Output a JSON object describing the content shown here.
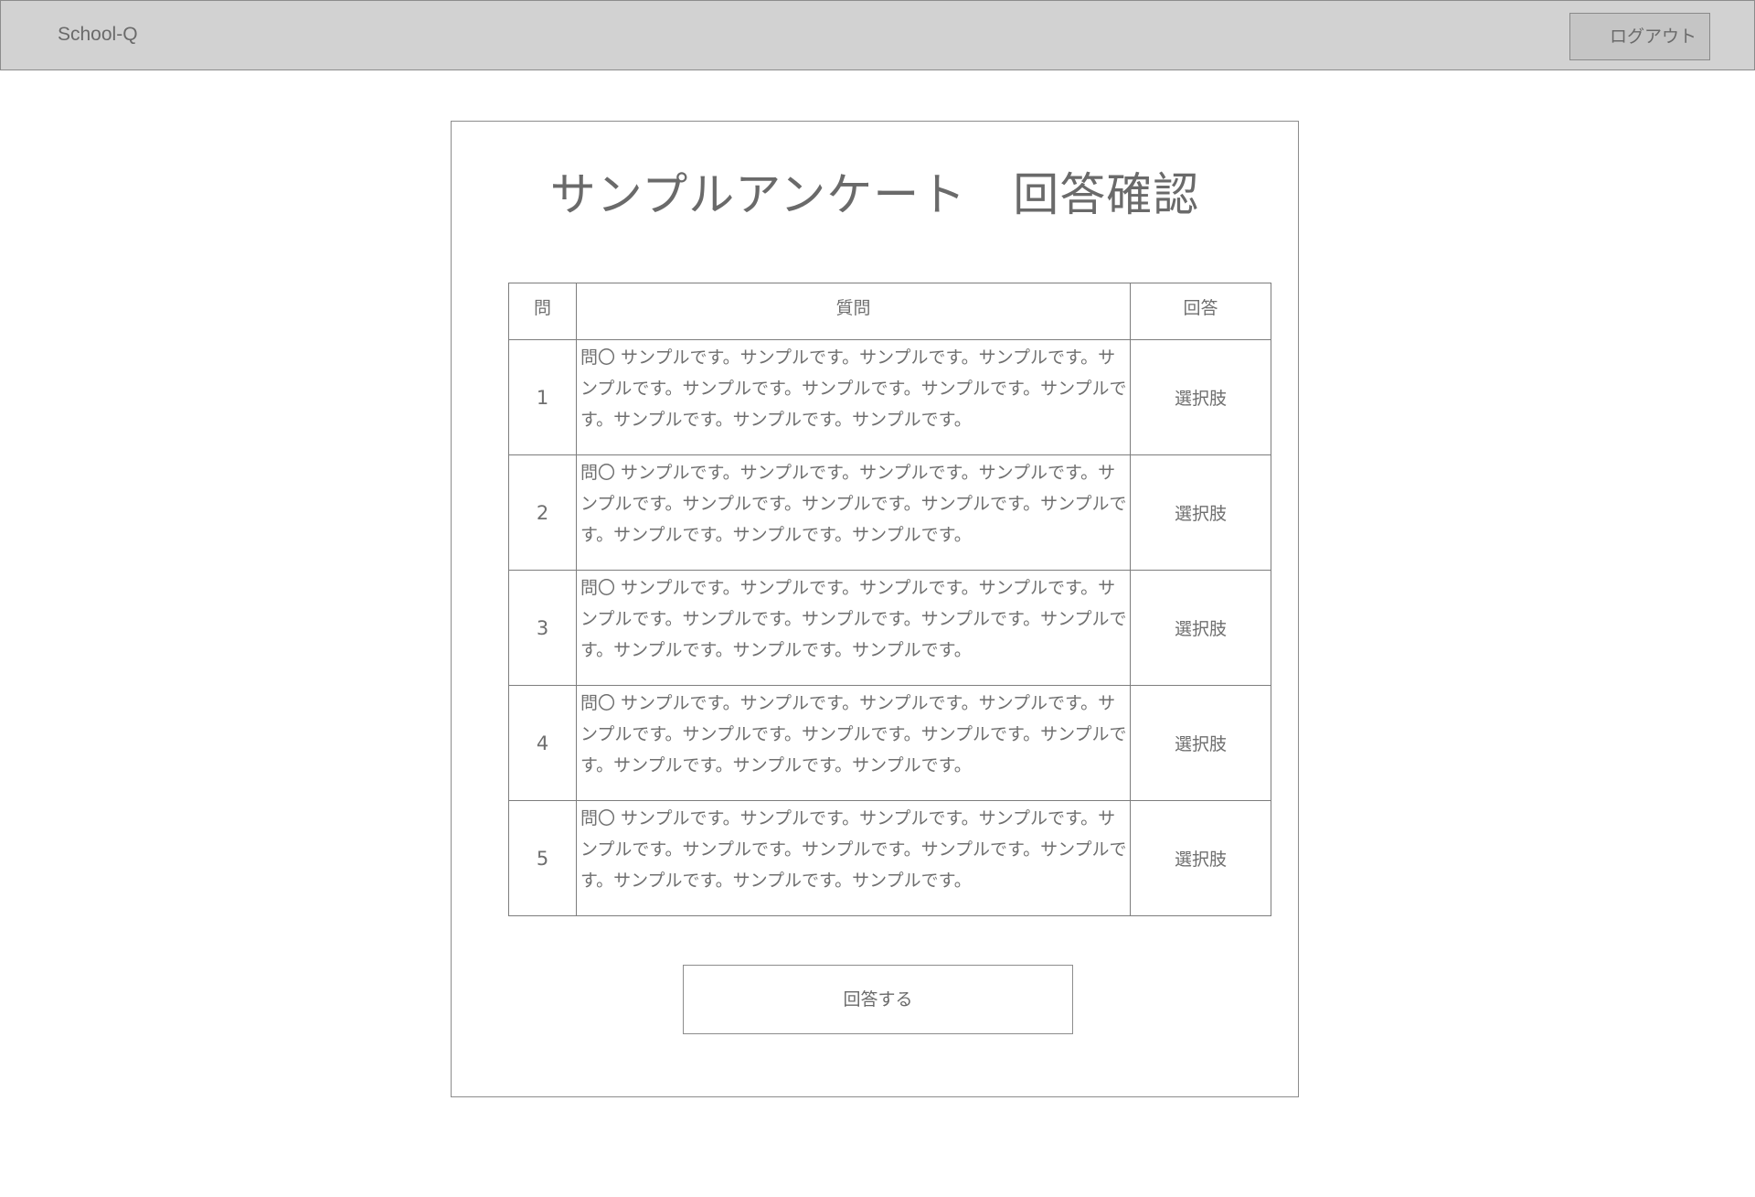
{
  "header": {
    "brand": "School-Q",
    "logout_label": "ログアウト"
  },
  "main": {
    "title": "サンプルアンケート　回答確認",
    "table": {
      "headers": [
        "問",
        "質問",
        "回答"
      ],
      "rows": [
        {
          "num": "1",
          "question": "問〇 サンプルです。サンプルです。サンプルです。サンプルです。サンプルです。サンプルです。サンプルです。サンプルです。サンプルです。サンプルです。サンプルです。サンプルです。",
          "answer": "選択肢"
        },
        {
          "num": "2",
          "question": "問〇 サンプルです。サンプルです。サンプルです。サンプルです。サンプルです。サンプルです。サンプルです。サンプルです。サンプルです。サンプルです。サンプルです。サンプルです。",
          "answer": "選択肢"
        },
        {
          "num": "3",
          "question": "問〇 サンプルです。サンプルです。サンプルです。サンプルです。サンプルです。サンプルです。サンプルです。サンプルです。サンプルです。サンプルです。サンプルです。サンプルです。",
          "answer": "選択肢"
        },
        {
          "num": "4",
          "question": "問〇 サンプルです。サンプルです。サンプルです。サンプルです。サンプルです。サンプルです。サンプルです。サンプルです。サンプルです。サンプルです。サンプルです。サンプルです。",
          "answer": "選択肢"
        },
        {
          "num": "5",
          "question": "問〇 サンプルです。サンプルです。サンプルです。サンプルです。サンプルです。サンプルです。サンプルです。サンプルです。サンプルです。サンプルです。サンプルです。サンプルです。",
          "answer": "選択肢"
        }
      ]
    },
    "submit_label": "回答する"
  }
}
